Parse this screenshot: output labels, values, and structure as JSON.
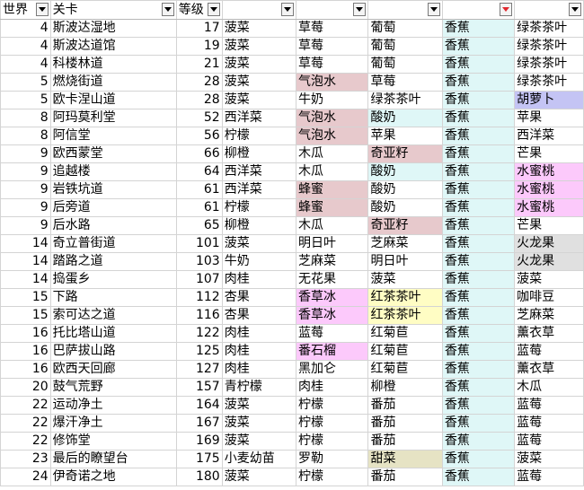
{
  "headers": [
    {
      "label": "世界",
      "filter_icon": "dropdown-arrow-icon"
    },
    {
      "label": "关卡",
      "filter_icon": "dropdown-arrow-icon"
    },
    {
      "label": "等级",
      "filter_icon": "dropdown-arrow-icon"
    },
    {
      "label": "",
      "filter_icon": "dropdown-arrow-icon"
    },
    {
      "label": "",
      "filter_icon": "dropdown-arrow-icon"
    },
    {
      "label": "",
      "filter_icon": "dropdown-arrow-icon"
    },
    {
      "label": "",
      "filter_icon": "dropdown-arrow-icon",
      "filter_active": true
    },
    {
      "label": "",
      "filter_icon": "dropdown-arrow-icon"
    }
  ],
  "colors": {
    "blue": "#dff7f7",
    "pink": "#e7c9cc",
    "magenta": "#fcc9fb",
    "yellow": "#fffdc4",
    "grey": "#e0e0e0",
    "lavender": "#c4c4f4",
    "khaki": "#e6e3c4",
    "active_filter_arrow": "#e0282f"
  },
  "rows": [
    {
      "world": "4",
      "level": "斯波达湿地",
      "grade": "17",
      "a": "菠菜",
      "b": "草莓",
      "c": "葡萄",
      "d": "香蕉",
      "e": "绿茶茶叶"
    },
    {
      "world": "4",
      "level": "斯波达道馆",
      "grade": "19",
      "a": "菠菜",
      "b": "草莓",
      "c": "葡萄",
      "d": "香蕉",
      "e": "绿茶茶叶"
    },
    {
      "world": "4",
      "level": "科楼林道",
      "grade": "21",
      "a": "菠菜",
      "b": "草莓",
      "c": "葡萄",
      "d": "香蕉",
      "e": "绿茶茶叶"
    },
    {
      "world": "5",
      "level": "燃烧街道",
      "grade": "28",
      "a": "菠菜",
      "b": "气泡水",
      "c": "草莓",
      "d": "香蕉",
      "e": "绿茶茶叶"
    },
    {
      "world": "5",
      "level": "欧卡涅山道",
      "grade": "28",
      "a": "菠菜",
      "b": "牛奶",
      "c": "绿茶茶叶",
      "d": "香蕉",
      "e": "胡萝卜"
    },
    {
      "world": "8",
      "level": "阿玛莫利堂",
      "grade": "52",
      "a": "西洋菜",
      "b": "气泡水",
      "c": "酸奶",
      "d": "香蕉",
      "e": "苹果"
    },
    {
      "world": "8",
      "level": "阿信堂",
      "grade": "56",
      "a": "柠檬",
      "b": "气泡水",
      "c": "苹果",
      "d": "香蕉",
      "e": "西洋菜"
    },
    {
      "world": "9",
      "level": "欧西蒙堂",
      "grade": "66",
      "a": "柳橙",
      "b": "木瓜",
      "c": "奇亚籽",
      "d": "香蕉",
      "e": "芒果"
    },
    {
      "world": "9",
      "level": "追越楼",
      "grade": "64",
      "a": "西洋菜",
      "b": "木瓜",
      "c": "酸奶",
      "d": "香蕉",
      "e": "水蜜桃"
    },
    {
      "world": "9",
      "level": "岩铁坑道",
      "grade": "61",
      "a": "西洋菜",
      "b": "蜂蜜",
      "c": "酸奶",
      "d": "香蕉",
      "e": "水蜜桃"
    },
    {
      "world": "9",
      "level": "后旁道",
      "grade": "61",
      "a": "柠檬",
      "b": "蜂蜜",
      "c": "酸奶",
      "d": "香蕉",
      "e": "水蜜桃"
    },
    {
      "world": "9",
      "level": "后水路",
      "grade": "65",
      "a": "柳橙",
      "b": "木瓜",
      "c": "奇亚籽",
      "d": "香蕉",
      "e": "芒果"
    },
    {
      "world": "14",
      "level": "奇立普街道",
      "grade": "101",
      "a": "菠菜",
      "b": "明日叶",
      "c": "芝麻菜",
      "d": "香蕉",
      "e": "火龙果"
    },
    {
      "world": "14",
      "level": "踏路之道",
      "grade": "103",
      "a": "牛奶",
      "b": "芝麻菜",
      "c": "明日叶",
      "d": "香蕉",
      "e": "火龙果"
    },
    {
      "world": "14",
      "level": "捣蛋乡",
      "grade": "107",
      "a": "肉桂",
      "b": "无花果",
      "c": "菠菜",
      "d": "香蕉",
      "e": "菠菜"
    },
    {
      "world": "15",
      "level": "下路",
      "grade": "112",
      "a": "杏果",
      "b": "香草冰",
      "c": "红茶茶叶",
      "d": "香蕉",
      "e": "咖啡豆"
    },
    {
      "world": "15",
      "level": "索可达之道",
      "grade": "116",
      "a": "杏果",
      "b": "香草冰",
      "c": "红茶茶叶",
      "d": "香蕉",
      "e": "芝麻菜"
    },
    {
      "world": "16",
      "level": "托比塔山道",
      "grade": "122",
      "a": "肉桂",
      "b": "蓝莓",
      "c": "红菊苣",
      "d": "香蕉",
      "e": "薰衣草"
    },
    {
      "world": "16",
      "level": "巴萨拔山路",
      "grade": "125",
      "a": "肉桂",
      "b": "番石榴",
      "c": "红菊苣",
      "d": "香蕉",
      "e": "蓝莓"
    },
    {
      "world": "16",
      "level": "欧西天回廊",
      "grade": "127",
      "a": "肉桂",
      "b": "黑加仑",
      "c": "红菊苣",
      "d": "香蕉",
      "e": "薰衣草"
    },
    {
      "world": "20",
      "level": "鼓气荒野",
      "grade": "157",
      "a": "青柠檬",
      "b": "肉桂",
      "c": "柳橙",
      "d": "香蕉",
      "e": "木瓜"
    },
    {
      "world": "22",
      "level": "运动净土",
      "grade": "164",
      "a": "菠菜",
      "b": "柠檬",
      "c": "番茄",
      "d": "香蕉",
      "e": "蓝莓"
    },
    {
      "world": "22",
      "level": "爆汗净土",
      "grade": "167",
      "a": "菠菜",
      "b": "柠檬",
      "c": "番茄",
      "d": "香蕉",
      "e": "蓝莓"
    },
    {
      "world": "22",
      "level": "修饰堂",
      "grade": "169",
      "a": "菠菜",
      "b": "柠檬",
      "c": "番茄",
      "d": "香蕉",
      "e": "蓝莓"
    },
    {
      "world": "23",
      "level": "最后的瞭望台",
      "grade": "175",
      "a": "小麦幼苗",
      "b": "罗勒",
      "c": "甜菜",
      "d": "香蕉",
      "e": "菠菜"
    },
    {
      "world": "24",
      "level": "伊奇诺之地",
      "grade": "180",
      "a": "菠菜",
      "b": "柠檬",
      "c": "番茄",
      "d": "香蕉",
      "e": "蓝莓"
    }
  ],
  "cell_colors": {
    "3": {
      "b": "pink"
    },
    "4": {
      "e": "lavender"
    },
    "5": {
      "b": "pink",
      "c": "blue"
    },
    "6": {
      "b": "pink"
    },
    "7": {
      "c": "pink"
    },
    "8": {
      "c": "blue",
      "e": "magenta"
    },
    "9": {
      "b": "pink",
      "e": "magenta"
    },
    "10": {
      "b": "pink",
      "e": "magenta"
    },
    "11": {
      "c": "pink"
    },
    "12": {
      "e": "grey"
    },
    "13": {
      "e": "grey"
    },
    "15": {
      "b": "magenta",
      "c": "yellow"
    },
    "16": {
      "b": "magenta",
      "c": "yellow"
    },
    "18": {
      "b": "magenta"
    },
    "24": {
      "c": "khaki"
    }
  }
}
